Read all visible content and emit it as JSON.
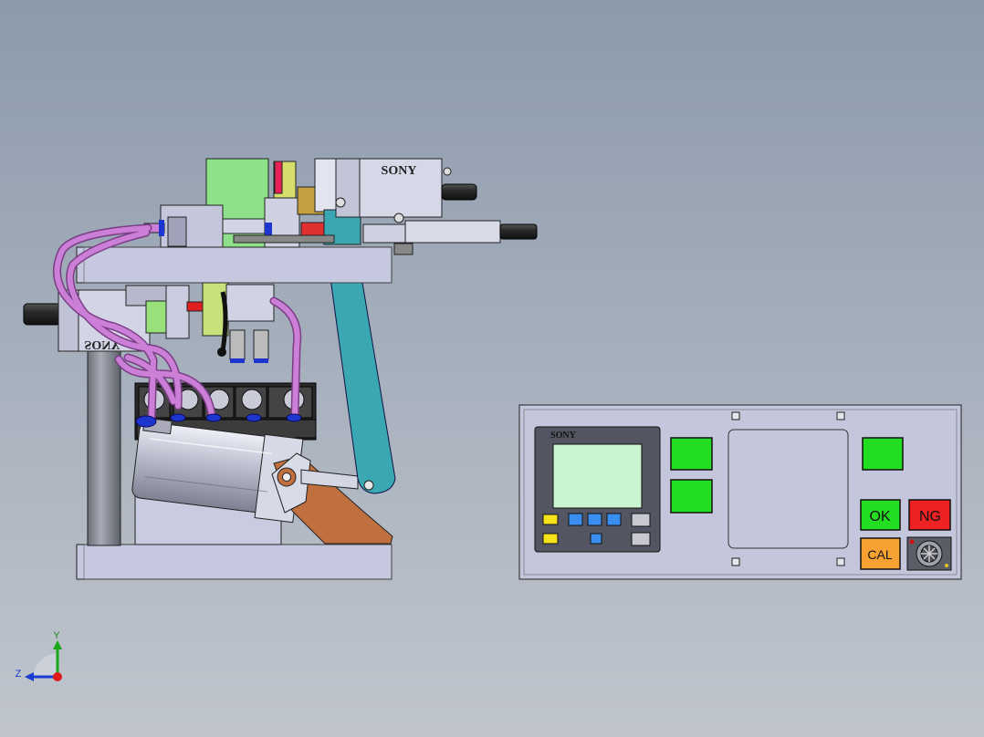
{
  "machine": {
    "camera_top_brand": "SONY",
    "camera_left_brand": "SONY"
  },
  "control_panel": {
    "hmi_brand": "SONY",
    "ok_label": "OK",
    "ng_label": "NG",
    "cal_label": "CAL"
  },
  "triad": {
    "y_label": "Y",
    "z_label": "Z"
  },
  "colors": {
    "background_top": "#8c9aab",
    "frame_metal": "#c4c6de",
    "tube_purple": "#cc7fd6",
    "arm_teal": "#3aa7b3",
    "bracket_copper": "#c0703f",
    "block_green": "#8fe08a",
    "button_green": "#22dd22",
    "button_red": "#ee2222",
    "button_orange": "#f7a132"
  }
}
